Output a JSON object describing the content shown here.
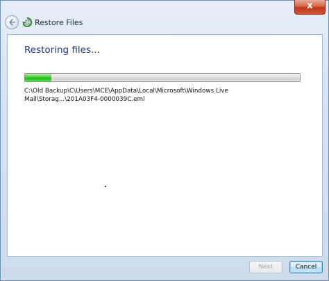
{
  "window": {
    "title": "Restore Files",
    "close_glyph": "x"
  },
  "icons": {
    "back": "back-arrow-icon",
    "app": "restore-files-icon",
    "close": "close-icon"
  },
  "content": {
    "heading": "Restoring files...",
    "progress_fraction": 0.095,
    "current_file": "C:\\Old Backup\\C\\Users\\MCE\\AppData\\Local\\Microsoft\\Windows Live Mail\\Storag...\\201A03F4-0000039C.eml"
  },
  "footer": {
    "next_label": "Next",
    "cancel_label": "Cancel"
  },
  "colors": {
    "heading": "#1e3a8c",
    "progress_green": "#22b818",
    "close_red": "#c2361b"
  }
}
